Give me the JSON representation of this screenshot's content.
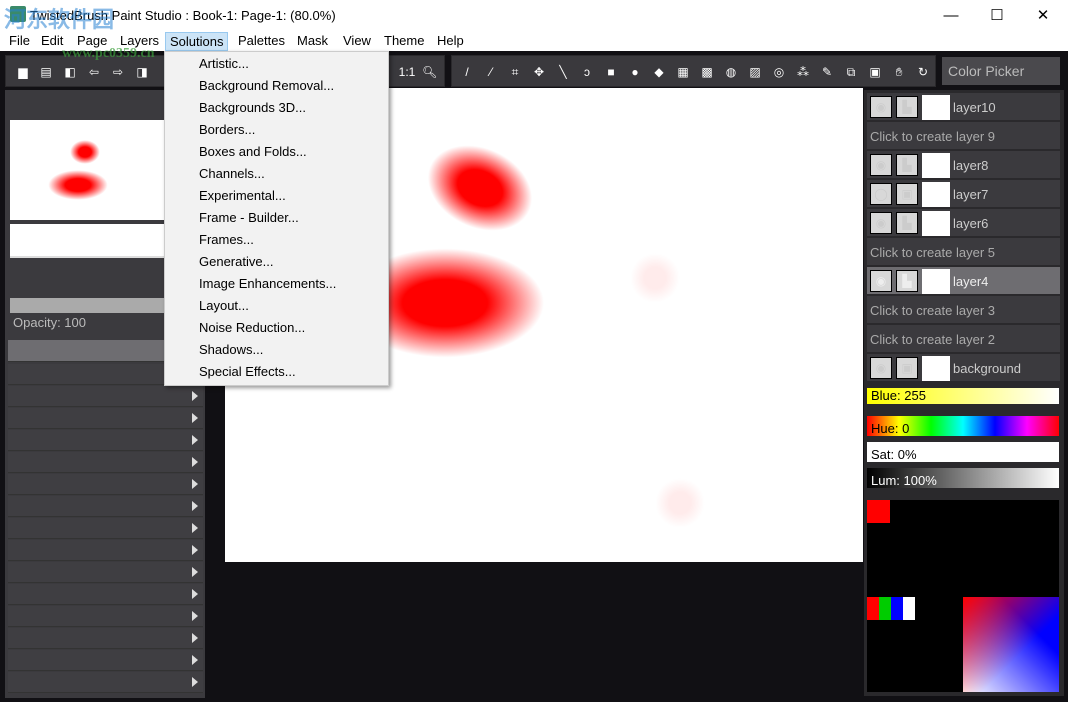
{
  "window": {
    "title": "TwistedBrush Paint Studio : Book-1: Page-1:  (80.0%)",
    "minimize": "—",
    "maximize": "☐",
    "close": "✕"
  },
  "watermark": {
    "text": "河东软件园",
    "url": "www.pc0359.cn"
  },
  "menubar": [
    "File",
    "Edit",
    "Page",
    "Layers",
    "Solutions",
    "Palettes",
    "Mask",
    "View",
    "Theme",
    "Help"
  ],
  "solutions_menu": [
    "Artistic...",
    "Background Removal...",
    "Backgrounds 3D...",
    "Borders...",
    "Boxes and Folds...",
    "Channels...",
    "Experimental...",
    "Frame - Builder...",
    "Frames...",
    "Generative...",
    "Image Enhancements...",
    "Layout...",
    "Noise Reduction...",
    "Shadows...",
    "Special Effects..."
  ],
  "toolbar": {
    "zoom_label": "1:1",
    "color_picker": "Color Picker"
  },
  "left_panel": {
    "opacity": "Opacity: 100"
  },
  "layers": [
    {
      "name": "layer10",
      "visible": true,
      "locked": false
    },
    {
      "create": "Click to create layer 9"
    },
    {
      "name": "layer8",
      "visible": true,
      "locked": false
    },
    {
      "name": "layer7",
      "visible": false,
      "locked": true
    },
    {
      "name": "layer6",
      "visible": true,
      "locked": false
    },
    {
      "create": "Click to create layer 5"
    },
    {
      "name": "layer4",
      "visible": true,
      "locked": false,
      "selected": true
    },
    {
      "create": "Click to create layer 3"
    },
    {
      "create": "Click to create layer 2"
    },
    {
      "name": "background",
      "visible": true,
      "locked": true
    }
  ],
  "color": {
    "blue": "Blue: 255",
    "hue": "Hue: 0",
    "sat": "Sat: 0%",
    "lum": "Lum: 100%",
    "current": "#ff0000",
    "swatches": [
      "#ff0000",
      "#00cc00",
      "#0000ff",
      "#ffffff"
    ]
  }
}
